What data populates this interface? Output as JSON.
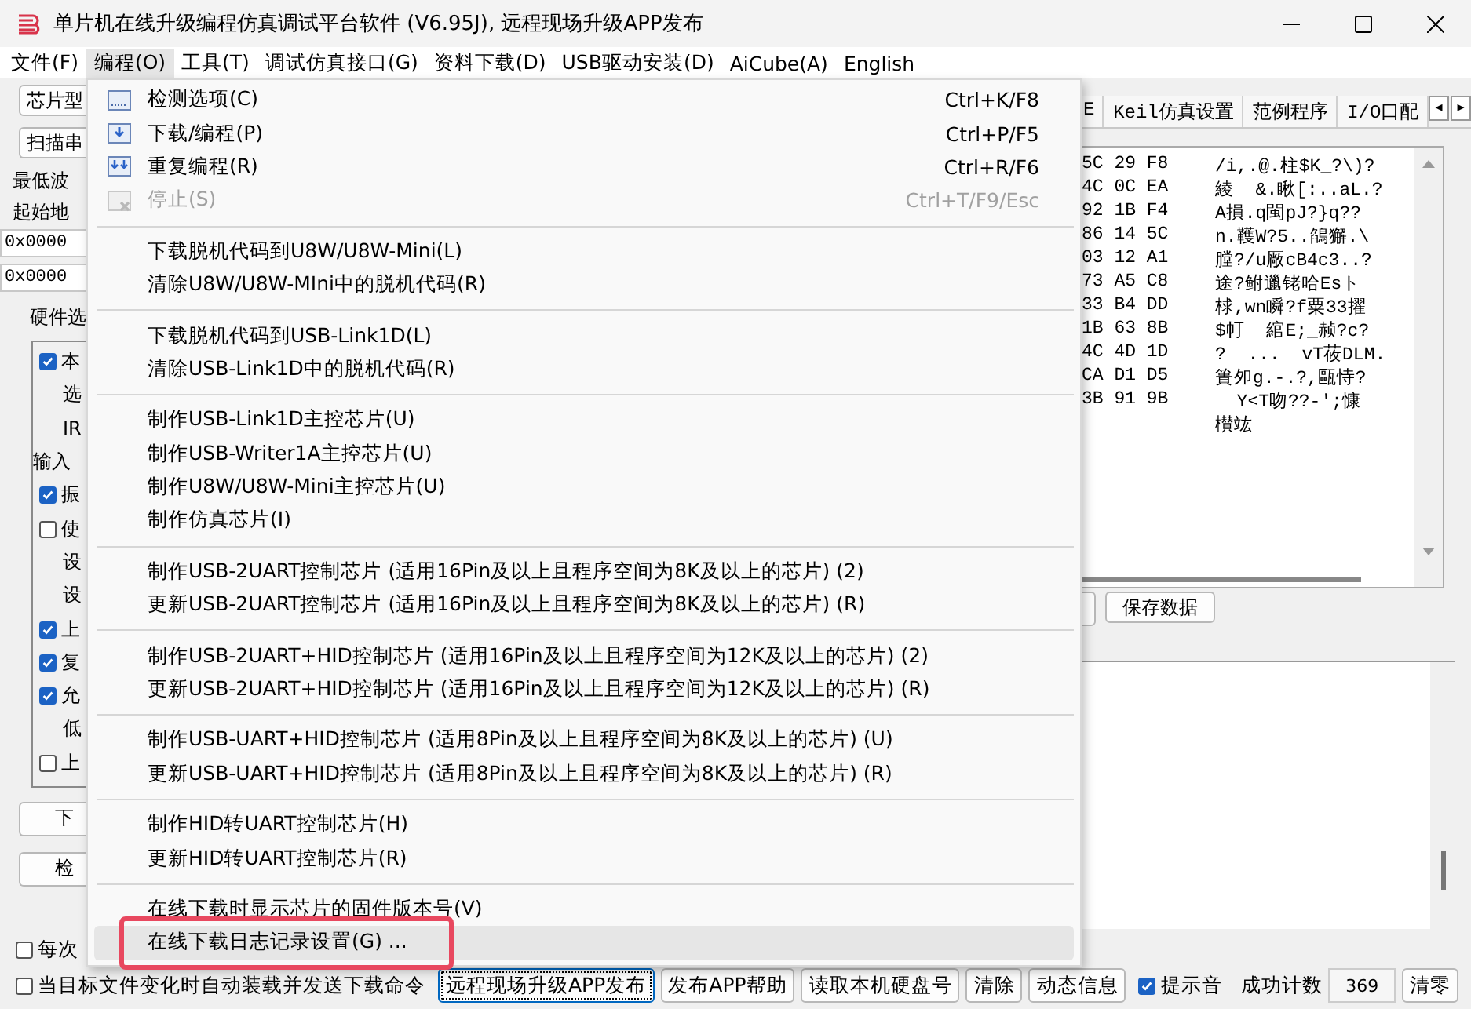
{
  "window": {
    "title": "单片机在线升级编程仿真调试平台软件 (V6.95J), 远程现场升级APP发布"
  },
  "menubar": [
    {
      "label": "文件(F)",
      "selected": false
    },
    {
      "label": "编程(O)",
      "selected": true
    },
    {
      "label": "工具(T)",
      "selected": false
    },
    {
      "label": "调试仿真接口(G)",
      "selected": false
    },
    {
      "label": "资料下载(D)",
      "selected": false
    },
    {
      "label": "USB驱动安装(D)",
      "selected": false
    },
    {
      "label": "AiCube(A)",
      "selected": false
    },
    {
      "label": "English",
      "selected": false
    }
  ],
  "left_panel": {
    "buttons_top": [
      "芯片型",
      "扫描串"
    ],
    "label_1": "最低波",
    "label_2": "起始地",
    "fields": [
      "0x0000",
      "0x0000"
    ],
    "group_title": "硬件选",
    "group_items": [
      {
        "kind": "checkbox",
        "label": "本",
        "checked": true
      },
      {
        "kind": "option",
        "label": "选"
      },
      {
        "kind": "option",
        "label": "IR"
      },
      {
        "kind": "label",
        "label": "输入"
      },
      {
        "kind": "checkbox",
        "label": "振",
        "checked": true
      },
      {
        "kind": "checkbox",
        "label": "使",
        "checked": false
      },
      {
        "kind": "option",
        "label": "设"
      },
      {
        "kind": "option",
        "label": "设"
      },
      {
        "kind": "checkbox",
        "label": "上",
        "checked": true
      },
      {
        "kind": "checkbox",
        "label": "复",
        "checked": true
      },
      {
        "kind": "checkbox",
        "label": "允",
        "checked": true
      },
      {
        "kind": "option",
        "label": "低"
      },
      {
        "kind": "checkbox",
        "label": "上",
        "checked": false
      }
    ],
    "buttons_bottom": [
      "下",
      "检"
    ]
  },
  "right_panel": {
    "tabs": [
      {
        "label": "E"
      },
      {
        "label": "Keil仿真设置"
      },
      {
        "label": "范例程序"
      },
      {
        "label": "I/O口配"
      }
    ],
    "tab_scroll": [
      "◂",
      "▸"
    ],
    "hex_rows": [
      {
        "hex": "5C 29 F8",
        "text": "/i,.@.柱$K_?\\)?"
      },
      {
        "hex": "4C 0C EA",
        "text": "綾  &.瞅[:..aL.?"
      },
      {
        "hex": "92 1B F4",
        "text": "A損.q閩pJ?}q??"
      },
      {
        "hex": "86 14 5C",
        "text": "n.韄W?5..鵮獬.\\"
      },
      {
        "hex": "03 12 A1",
        "text": "膛?/u厰cB4c3..?"
      },
      {
        "hex": "73 A5 C8",
        "text": "途?鲋邋铑哈Esト"
      },
      {
        "hex": "33 B4 DD",
        "text": "梂,wn瞬?f粟33擢"
      },
      {
        "hex": "1B 63 8B",
        "text": "$帄  綰E;_赪?c?"
      },
      {
        "hex": "4C 4D 1D",
        "text": "?  ...  vT莜DLM."
      },
      {
        "hex": "CA D1 D5",
        "text": "簣夘g.-.?,甌恃?"
      },
      {
        "hex": "3B 91 9B",
        "text": "  Y<T吻??-';慷"
      },
      {
        "hex": "",
        "text": "櫕竑"
      }
    ],
    "save_button": "保存数据"
  },
  "bottom": {
    "checkboxes": [
      {
        "label": "每次",
        "checked": false
      },
      {
        "label": "当目标文件变化时自动装载并发送下载命令",
        "checked": false
      }
    ],
    "buttons": [
      {
        "label": "远程现场升级APP发布",
        "selected": true
      },
      {
        "label": "发布APP帮助",
        "selected": false
      },
      {
        "label": "读取本机硬盘号",
        "selected": false
      },
      {
        "label": "清除",
        "selected": false
      },
      {
        "label": "动态信息",
        "selected": false
      }
    ],
    "sound": {
      "label": "提示音",
      "checked": true
    },
    "count_label": "成功计数",
    "count": "369",
    "reset_button": "清零"
  },
  "menu": {
    "groups": [
      {
        "items": [
          {
            "kind": "icon",
            "label": "检测选项(C)",
            "shortcut": "Ctrl+K/F8",
            "disabled": false,
            "highlighted": false,
            "outlined": false
          },
          {
            "kind": "icon",
            "label": "下载/编程(P)",
            "shortcut": "Ctrl+P/F5",
            "disabled": false,
            "highlighted": false,
            "outlined": false
          },
          {
            "kind": "icon",
            "label": "重复编程(R)",
            "shortcut": "Ctrl+R/F6",
            "disabled": false,
            "highlighted": false,
            "outlined": false
          },
          {
            "kind": "icon",
            "label": "停止(S)",
            "shortcut": "Ctrl+T/F9/Esc",
            "disabled": true,
            "highlighted": false,
            "outlined": false
          }
        ]
      },
      {
        "items": [
          {
            "kind": "plain",
            "label": "下载脱机代码到U8W/U8W-Mini(L)",
            "disabled": false,
            "highlighted": false,
            "outlined": false
          },
          {
            "kind": "plain",
            "label": "清除U8W/U8W-MIni中的脱机代码(R)",
            "disabled": false,
            "highlighted": false,
            "outlined": false
          }
        ]
      },
      {
        "items": [
          {
            "kind": "plain",
            "label": "下载脱机代码到USB-Link1D(L)",
            "disabled": false,
            "highlighted": false,
            "outlined": false
          },
          {
            "kind": "plain",
            "label": "清除USB-Link1D中的脱机代码(R)",
            "disabled": false,
            "highlighted": false,
            "outlined": false
          }
        ]
      },
      {
        "items": [
          {
            "kind": "plain",
            "label": "制作USB-Link1D主控芯片(U)",
            "disabled": false,
            "highlighted": false,
            "outlined": false
          },
          {
            "kind": "plain",
            "label": "制作USB-Writer1A主控芯片(U)",
            "disabled": false,
            "highlighted": false,
            "outlined": false
          },
          {
            "kind": "plain",
            "label": "制作U8W/U8W-Mini主控芯片(U)",
            "disabled": false,
            "highlighted": false,
            "outlined": false
          },
          {
            "kind": "plain",
            "label": "制作仿真芯片(I)",
            "disabled": false,
            "highlighted": false,
            "outlined": false
          }
        ]
      },
      {
        "items": [
          {
            "kind": "plain",
            "label": "制作USB-2UART控制芯片 (适用16Pin及以上且程序空间为8K及以上的芯片) (2)",
            "disabled": false,
            "highlighted": false,
            "outlined": false
          },
          {
            "kind": "plain",
            "label": "更新USB-2UART控制芯片 (适用16Pin及以上且程序空间为8K及以上的芯片) (R)",
            "disabled": false,
            "highlighted": false,
            "outlined": false
          }
        ]
      },
      {
        "items": [
          {
            "kind": "plain",
            "label": "制作USB-2UART+HID控制芯片 (适用16Pin及以上且程序空间为12K及以上的芯片) (2)",
            "disabled": false,
            "highlighted": false,
            "outlined": false
          },
          {
            "kind": "plain",
            "label": "更新USB-2UART+HID控制芯片 (适用16Pin及以上且程序空间为12K及以上的芯片) (R)",
            "disabled": false,
            "highlighted": false,
            "outlined": false
          }
        ]
      },
      {
        "items": [
          {
            "kind": "plain",
            "label": "制作USB-UART+HID控制芯片 (适用8Pin及以上且程序空间为8K及以上的芯片) (U)",
            "disabled": false,
            "highlighted": false,
            "outlined": false
          },
          {
            "kind": "plain",
            "label": "更新USB-UART+HID控制芯片 (适用8Pin及以上且程序空间为8K及以上的芯片) (R)",
            "disabled": false,
            "highlighted": false,
            "outlined": false
          }
        ]
      },
      {
        "items": [
          {
            "kind": "plain",
            "label": "制作HID转UART控制芯片(H)",
            "disabled": false,
            "highlighted": false,
            "outlined": false
          },
          {
            "kind": "plain",
            "label": "更新HID转UART控制芯片(R)",
            "disabled": false,
            "highlighted": false,
            "outlined": false
          }
        ]
      },
      {
        "items": [
          {
            "kind": "plain",
            "label": "在线下载时显示芯片的固件版本号(V)",
            "disabled": false,
            "highlighted": false,
            "outlined": false
          },
          {
            "kind": "plain",
            "label": "在线下载日志记录设置(G) ...",
            "disabled": false,
            "highlighted": true,
            "outlined": true
          }
        ]
      }
    ]
  }
}
